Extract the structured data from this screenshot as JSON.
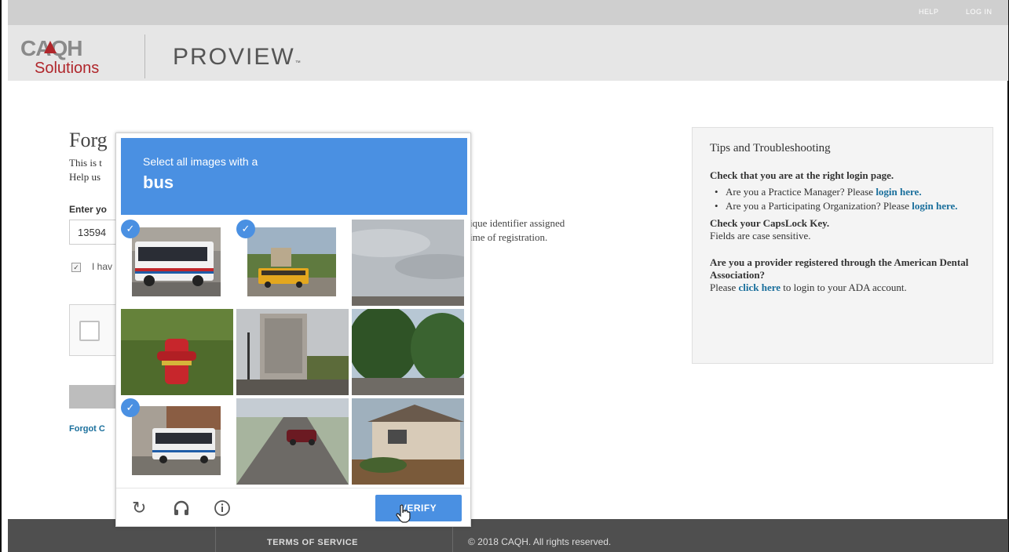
{
  "topnav": {
    "help": "HELP",
    "login": "LOG IN"
  },
  "header": {
    "logo_top": "CAQH",
    "logo_bottom": "Solutions",
    "brand": "PROVIEW",
    "brand_mark": "™"
  },
  "form": {
    "title": "Forg",
    "intro_line1": "This is t",
    "intro_line2": "Help us",
    "enter_label": "Enter yo",
    "id_value": "13594",
    "hint_line1": "ique identifier assigned",
    "hint_line2": "ime of registration.",
    "agree_text": "I hav",
    "forgot_link": "Forgot C"
  },
  "tips": {
    "heading": "Tips and Troubleshooting",
    "s1_title": "Check that you are at the right login page.",
    "b1_text": "Are you a Practice Manager? Please ",
    "b1_link": "login here.",
    "b2_text": "Are you a Participating Organization? Please ",
    "b2_link": "login here.",
    "s2_title": "Check your CapsLock Key.",
    "s2_text": "Fields are case sensitive.",
    "s3_title": "Are you a provider registered through the American Dental Association?",
    "s3_pre": "Please ",
    "s3_link": "click here",
    "s3_post": " to login to your ADA account."
  },
  "challenge": {
    "line1": "Select all images with a",
    "line2": "bus",
    "verify": "VERIFY",
    "tiles": [
      {
        "subject": "bus",
        "selected": true
      },
      {
        "subject": "school bus",
        "selected": true
      },
      {
        "subject": "sky",
        "selected": false
      },
      {
        "subject": "fire hydrant",
        "selected": false
      },
      {
        "subject": "building",
        "selected": false
      },
      {
        "subject": "trees",
        "selected": false
      },
      {
        "subject": "bus",
        "selected": true
      },
      {
        "subject": "street with car",
        "selected": false
      },
      {
        "subject": "house",
        "selected": false
      }
    ]
  },
  "footer": {
    "terms": "TERMS OF SERVICE",
    "copyright": "© 2018 CAQH. All rights reserved."
  },
  "colors": {
    "accent": "#4a90e2",
    "link": "#1a6f9c",
    "brand_red": "#b0262b",
    "footer": "#4f4f4f"
  },
  "icons": [
    "reload-icon",
    "headphones-icon",
    "info-icon",
    "check-icon",
    "hand-cursor-icon"
  ]
}
